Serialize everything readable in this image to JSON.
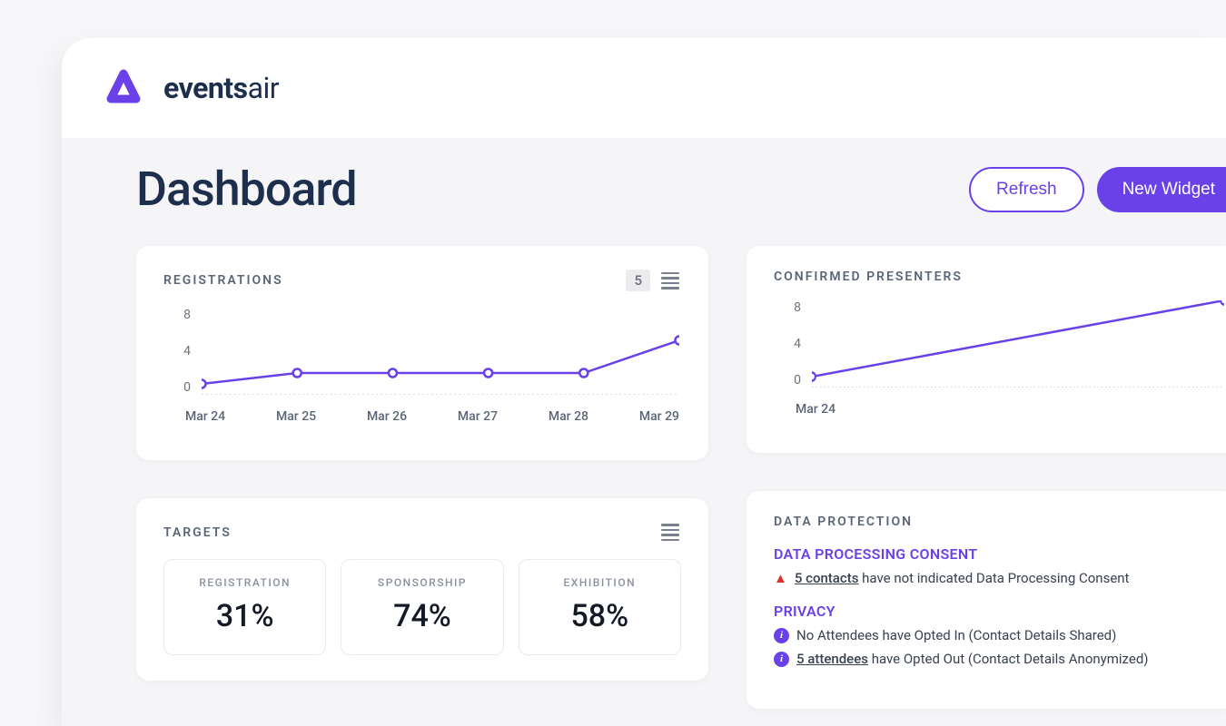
{
  "brand": {
    "name_bold": "events",
    "name_light": "air"
  },
  "page": {
    "title": "Dashboard"
  },
  "actions": {
    "refresh": "Refresh",
    "new_widget": "New Widget"
  },
  "widgets": {
    "registrations": {
      "title": "REGISTRATIONS",
      "count_badge": "5"
    },
    "confirmed_presenters": {
      "title": "CONFIRMED PRESENTERS"
    },
    "targets": {
      "title": "TARGETS",
      "items": [
        {
          "label": "REGISTRATION",
          "value": "31%"
        },
        {
          "label": "SPONSORSHIP",
          "value": "74%"
        },
        {
          "label": "EXHIBITION",
          "value": "58%"
        }
      ]
    },
    "data_protection": {
      "title": "DATA PROTECTION",
      "sections": [
        {
          "heading": "DATA PROCESSING CONSENT",
          "rows": [
            {
              "icon": "warn",
              "link": "5 contacts",
              "rest": " have not indicated Data Processing Consent"
            }
          ]
        },
        {
          "heading": "PRIVACY",
          "rows": [
            {
              "icon": "info",
              "link": "",
              "rest": "No Attendees have Opted In (Contact Details Shared)"
            },
            {
              "icon": "info",
              "link": "5 attendees",
              "rest": " have Opted Out (Contact Details Anonymized)"
            }
          ]
        }
      ]
    }
  },
  "chart_data": [
    {
      "type": "line",
      "title": "REGISTRATIONS",
      "ylabel": "",
      "ylim": [
        0,
        8
      ],
      "yticks": [
        8,
        4,
        0
      ],
      "categories": [
        "Mar 24",
        "Mar 25",
        "Mar 26",
        "Mar 27",
        "Mar 28",
        "Mar 29"
      ],
      "values": [
        1,
        2,
        2,
        2,
        2,
        5
      ]
    },
    {
      "type": "line",
      "title": "CONFIRMED PRESENTERS",
      "ylabel": "",
      "ylim": [
        0,
        8
      ],
      "yticks": [
        8,
        4,
        0
      ],
      "categories": [
        "Mar 24"
      ],
      "values": [
        1,
        8
      ]
    }
  ],
  "colors": {
    "accent": "#6a41e8"
  }
}
